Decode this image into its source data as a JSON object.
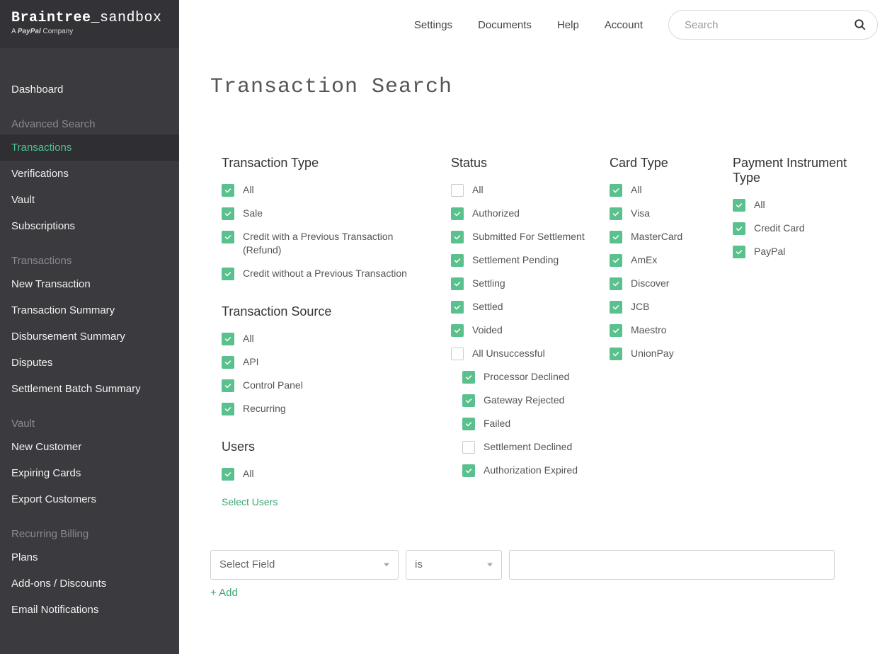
{
  "logo": {
    "brand": "Braintree",
    "suffix": "_sandbox",
    "tagline_prefix": "A ",
    "tagline_brand": "PayPal",
    "tagline_suffix": " Company"
  },
  "sidebar": {
    "dashboard": "Dashboard",
    "group_advancedsearch": "Advanced Search",
    "as_items": [
      "Transactions",
      "Verifications",
      "Vault",
      "Subscriptions"
    ],
    "group_transactions": "Transactions",
    "tx_items": [
      "New Transaction",
      "Transaction Summary",
      "Disbursement Summary",
      "Disputes",
      "Settlement Batch Summary"
    ],
    "group_vault": "Vault",
    "vault_items": [
      "New Customer",
      "Expiring Cards",
      "Export Customers"
    ],
    "group_recurring": "Recurring Billing",
    "rb_items": [
      "Plans",
      "Add-ons / Discounts",
      "Email Notifications"
    ]
  },
  "topnav": [
    "Settings",
    "Documents",
    "Help",
    "Account"
  ],
  "search_placeholder": "Search",
  "page_title": "Transaction Search",
  "filters": {
    "transaction_type": {
      "title": "Transaction Type",
      "items": [
        {
          "label": "All",
          "checked": true
        },
        {
          "label": "Sale",
          "checked": true
        },
        {
          "label": "Credit with a Previous Transaction (Refund)",
          "checked": true
        },
        {
          "label": "Credit without a Previous Transaction",
          "checked": true
        }
      ]
    },
    "transaction_source": {
      "title": "Transaction Source",
      "items": [
        {
          "label": "All",
          "checked": true
        },
        {
          "label": "API",
          "checked": true
        },
        {
          "label": "Control Panel",
          "checked": true
        },
        {
          "label": "Recurring",
          "checked": true
        }
      ]
    },
    "users": {
      "title": "Users",
      "items": [
        {
          "label": "All",
          "checked": true
        }
      ],
      "link": "Select Users"
    },
    "status": {
      "title": "Status",
      "items": [
        {
          "label": "All",
          "checked": false
        },
        {
          "label": "Authorized",
          "checked": true
        },
        {
          "label": "Submitted For Settlement",
          "checked": true
        },
        {
          "label": "Settlement Pending",
          "checked": true
        },
        {
          "label": "Settling",
          "checked": true
        },
        {
          "label": "Settled",
          "checked": true
        },
        {
          "label": "Voided",
          "checked": true
        },
        {
          "label": "All Unsuccessful",
          "checked": false
        }
      ],
      "sub_items": [
        {
          "label": "Processor Declined",
          "checked": true
        },
        {
          "label": "Gateway Rejected",
          "checked": true
        },
        {
          "label": "Failed",
          "checked": true
        },
        {
          "label": "Settlement Declined",
          "checked": false
        },
        {
          "label": "Authorization Expired",
          "checked": true
        }
      ]
    },
    "card_type": {
      "title": "Card Type",
      "items": [
        {
          "label": "All",
          "checked": true
        },
        {
          "label": "Visa",
          "checked": true
        },
        {
          "label": "MasterCard",
          "checked": true
        },
        {
          "label": "AmEx",
          "checked": true
        },
        {
          "label": "Discover",
          "checked": true
        },
        {
          "label": "JCB",
          "checked": true
        },
        {
          "label": "Maestro",
          "checked": true
        },
        {
          "label": "UnionPay",
          "checked": true
        }
      ]
    },
    "payment_instrument": {
      "title": "Payment Instrument Type",
      "items": [
        {
          "label": "All",
          "checked": true
        },
        {
          "label": "Credit Card",
          "checked": true
        },
        {
          "label": "PayPal",
          "checked": true
        }
      ]
    }
  },
  "field_row": {
    "select_field": "Select Field",
    "operator": "is",
    "add": "+ Add"
  }
}
